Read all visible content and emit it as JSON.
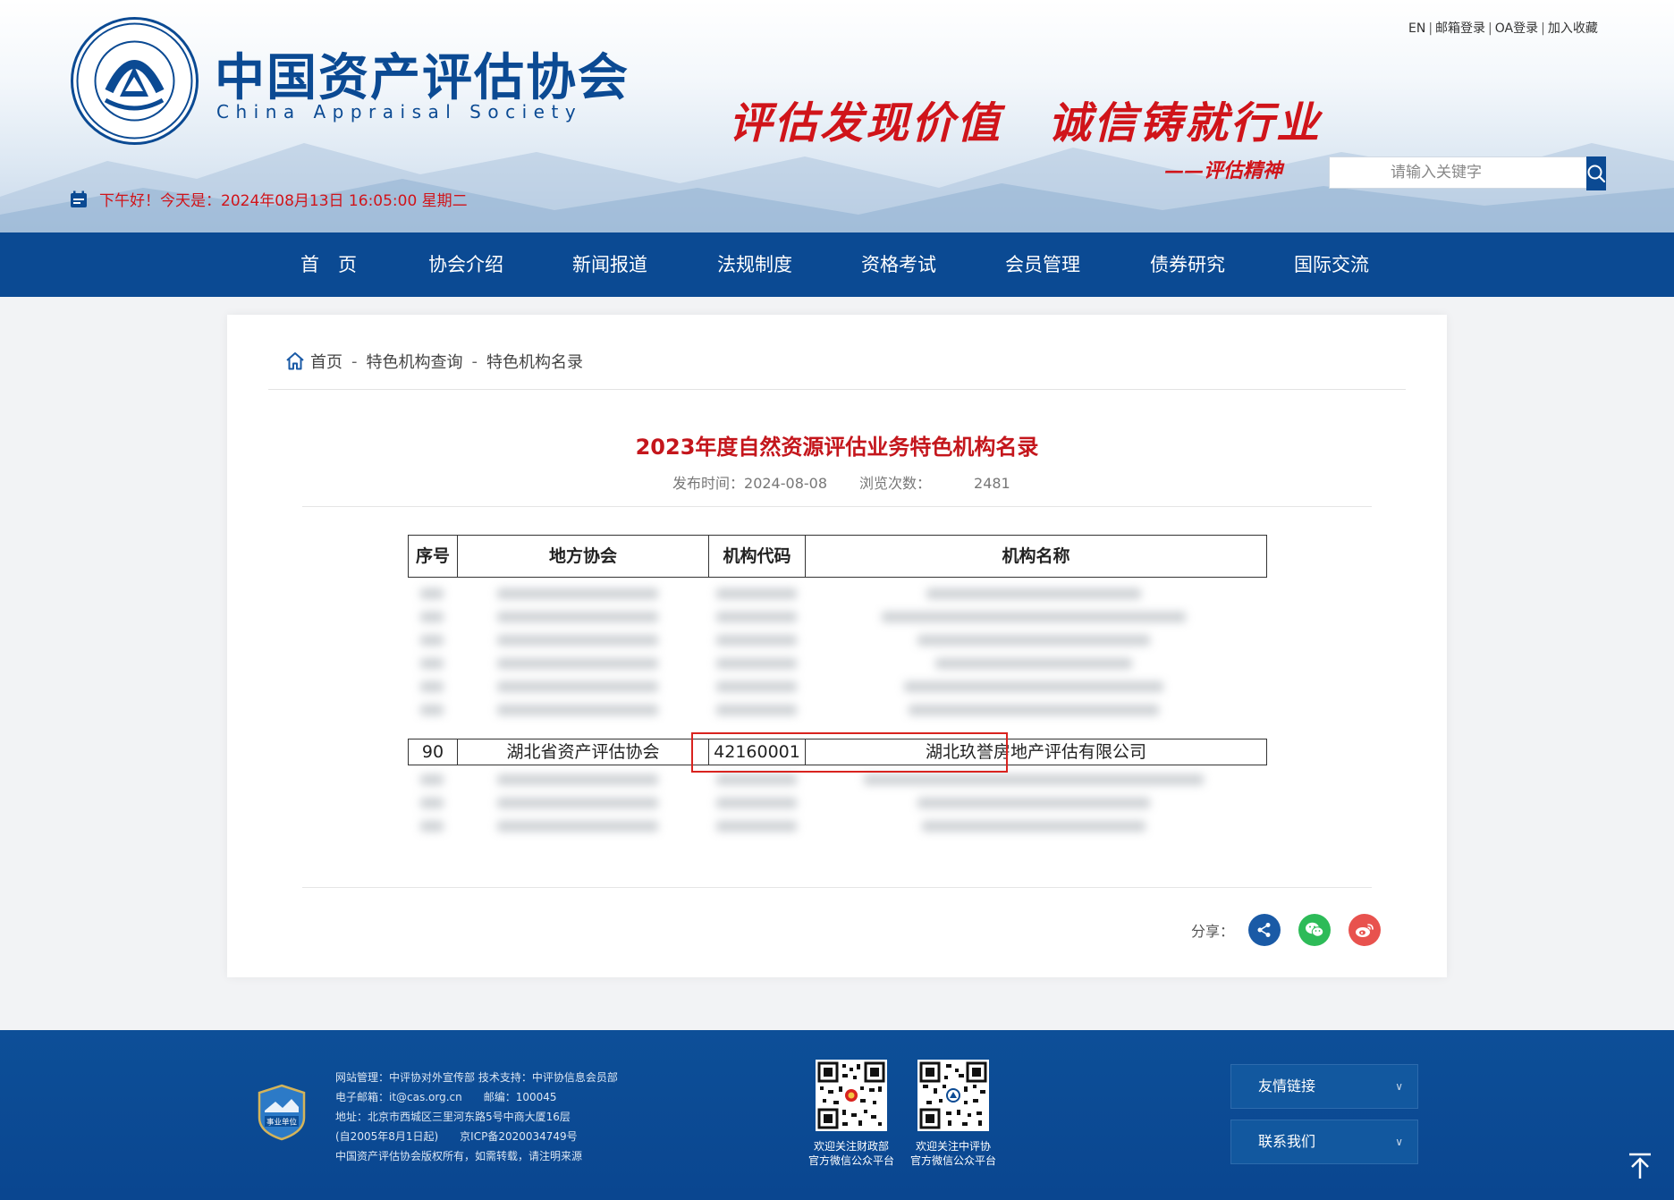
{
  "header": {
    "logo_title": "中国资产评估协会",
    "logo_subtitle": "China Appraisal Society",
    "slogan": "评估发现价值　诚信铸就行业",
    "slogan_sub": "——评估精神",
    "top_links": [
      "EN",
      "邮箱登录",
      "OA登录",
      "加入收藏"
    ],
    "search_placeholder": "请输入关键字",
    "greeting": "下午好！今天是：2024年08月13日 16:05:00 星期二"
  },
  "nav": {
    "items": [
      "首　页",
      "协会介绍",
      "新闻报道",
      "法规制度",
      "资格考试",
      "会员管理",
      "债券研究",
      "国际交流"
    ]
  },
  "breadcrumb": {
    "items": [
      "首页",
      "特色机构查询",
      "特色机构名录"
    ],
    "separator": "-"
  },
  "article": {
    "title": "2023年度自然资源评估业务特色机构名录",
    "publish_label": "发布时间：",
    "publish_date": "2024-08-08",
    "views_label": "浏览次数：",
    "views": "2481"
  },
  "table": {
    "headers": [
      "序号",
      "地方协会",
      "机构代码",
      "机构名称"
    ],
    "highlighted_row": {
      "index": "90",
      "association": "湖北省资产评估协会",
      "code": "42160001",
      "name": "湖北玖誉房地产评估有限公司"
    }
  },
  "share": {
    "label": "分享：",
    "buttons": [
      "share-icon",
      "wechat-icon",
      "weibo-icon"
    ],
    "colors": {
      "share": "#1a5aa6",
      "wechat": "#2dbb58",
      "weibo": "#e8524e"
    }
  },
  "footer": {
    "info_lines": [
      "网站管理：中评协对外宣传部 技术支持：中评协信息会员部",
      "电子邮箱：it@cas.org.cn　　邮编：100045",
      "地址：北京市西城区三里河东路5号中商大厦16层",
      "(自2005年8月1日起)　　京ICP备2020034749号",
      "中国资产评估协会版权所有，如需转载，请注明来源"
    ],
    "badge_label": "事业单位",
    "qr1_caption": [
      "欢迎关注财政部",
      "官方微信公众平台"
    ],
    "qr2_caption": [
      "欢迎关注中评协",
      "官方微信公众平台"
    ],
    "dropdowns": [
      "友情链接",
      "联系我们"
    ]
  },
  "colors": {
    "brand_blue": "#0b4a93",
    "accent_red": "#d0141a"
  }
}
